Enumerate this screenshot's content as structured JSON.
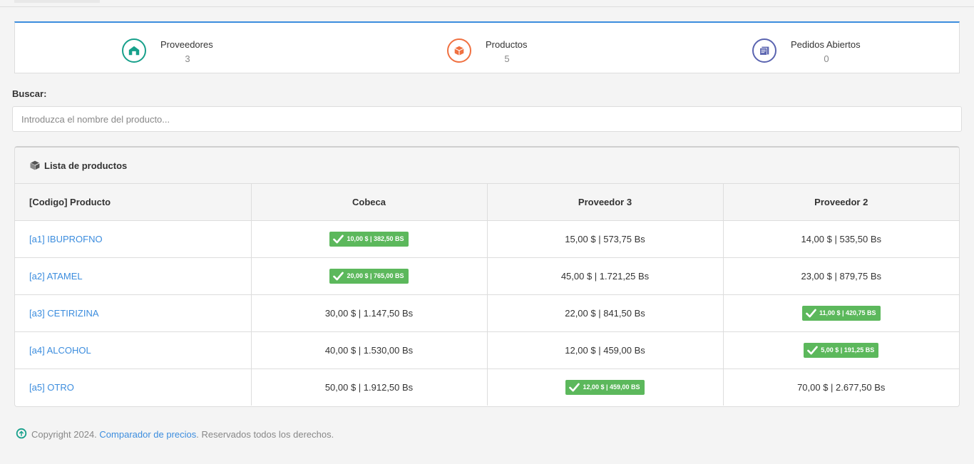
{
  "stats": {
    "suppliers": {
      "label": "Proveedores",
      "value": "3",
      "icon": "warehouse-icon",
      "color": "#17a08b"
    },
    "products": {
      "label": "Productos",
      "value": "5",
      "icon": "box-icon",
      "color": "#f07040"
    },
    "orders": {
      "label": "Pedidos Abiertos",
      "value": "0",
      "icon": "orders-icon",
      "color": "#5a64b0"
    }
  },
  "search": {
    "label": "Buscar:",
    "placeholder": "Introduzca el nombre del producto..."
  },
  "panel": {
    "title": "Lista de productos",
    "columns": [
      "[Codigo] Producto",
      "Cobeca",
      "Proveedor 3",
      "Proveedor 2"
    ],
    "rows": [
      {
        "product": "[a1] IBUPROFNO",
        "prices": [
          "10,00 $ | 382,50 BS",
          "15,00 $ | 573,75 Bs",
          "14,00 $ | 535,50 Bs"
        ],
        "best_index": 0
      },
      {
        "product": "[a2] ATAMEL",
        "prices": [
          "20,00 $ | 765,00 BS",
          "45,00 $ | 1.721,25 Bs",
          "23,00 $ | 879,75 Bs"
        ],
        "best_index": 0
      },
      {
        "product": "[a3] CETIRIZINA",
        "prices": [
          "30,00 $ | 1.147,50 Bs",
          "22,00 $ | 841,50 Bs",
          "11,00 $ | 420,75 BS"
        ],
        "best_index": 2
      },
      {
        "product": "[a4] ALCOHOL",
        "prices": [
          "40,00 $ | 1.530,00 Bs",
          "12,00 $ | 459,00 Bs",
          "5,00 $ | 191,25 BS"
        ],
        "best_index": 2
      },
      {
        "product": "[a5] OTRO",
        "prices": [
          "50,00 $ | 1.912,50 Bs",
          "12,00 $ | 459,00 BS",
          "70,00 $ | 2.677,50 Bs"
        ],
        "best_index": 1
      }
    ],
    "best_color": "#5cb85c"
  },
  "footer": {
    "prefix": "Copyright 2024.",
    "link": "Comparador de precios",
    "suffix": ". Reservados todos los derechos."
  }
}
